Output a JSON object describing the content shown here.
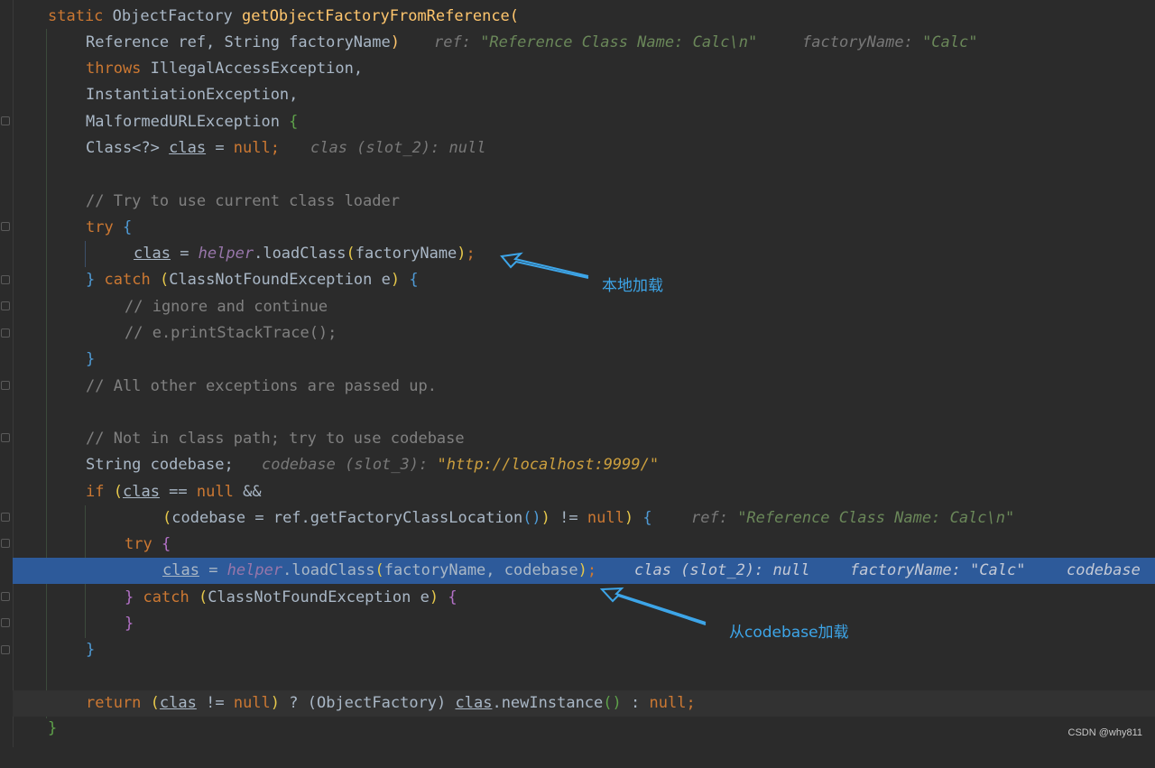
{
  "code": {
    "l1": {
      "kw": "static",
      "type": "ObjectFactory",
      "fn": "getObjectFactoryFromReference",
      "open": "("
    },
    "l2": {
      "text": "Reference ref, String factoryName",
      "close": ")",
      "hint1": "ref: ",
      "hint1v": "\"Reference Class Name: Calc\\n\"",
      "hint2": "factoryName: ",
      "hint2v": "\"Calc\""
    },
    "l3": {
      "kw": "throws",
      "text": " IllegalAccessException,"
    },
    "l4": {
      "text": "InstantiationException,"
    },
    "l5": {
      "text": "MalformedURLException ",
      "brace": "{"
    },
    "l6": {
      "pre": "Class<?> ",
      "var": "clas",
      "mid": " = ",
      "kw": "null",
      "end": ";",
      "hint": "clas (slot_2): null"
    },
    "l8": {
      "comment": "// Try to use current class loader"
    },
    "l9": {
      "kw": "try",
      "brace": "{"
    },
    "l10": {
      "var": "clas",
      "mid": " = ",
      "helper": "helper",
      "call": ".loadClass",
      "open": "(",
      "arg": "factoryName",
      "close": ")",
      "end": ";"
    },
    "l11": {
      "brace": "}",
      "kw": "catch",
      "open": "(",
      "text": "ClassNotFoundException e",
      "close": ")",
      "brace2": "{"
    },
    "l12": {
      "comment": "// ignore and continue"
    },
    "l13": {
      "comment": "// e.printStackTrace();"
    },
    "l14": {
      "brace": "}"
    },
    "l15": {
      "comment": "// All other exceptions are passed up."
    },
    "l17": {
      "comment": "// Not in class path; try to use codebase"
    },
    "l18": {
      "text": "String codebase;",
      "hint": "codebase (slot_3): ",
      "hintv": "\"http://localhost:9999/\""
    },
    "l19": {
      "kw": "if",
      "open": "(",
      "var": "clas",
      "mid": " == ",
      "kw2": "null",
      "end": " &&"
    },
    "l20": {
      "open": "(",
      "text": "codebase = ref.getFactoryClassLocation",
      "parens": "()",
      "close": ")",
      "mid": " != ",
      "kw": "null",
      "close2": ")",
      "brace": "{",
      "hint": "ref: ",
      "hintv": "\"Reference Class Name: Calc\\n\""
    },
    "l21": {
      "kw": "try",
      "brace": "{"
    },
    "l22": {
      "var": "clas",
      "mid": " = ",
      "helper": "helper",
      "call": ".loadClass",
      "open": "(",
      "arg": "factoryName, codebase",
      "close": ")",
      "end": ";",
      "hint1": "clas (slot_2): null",
      "hint2": "factoryName: ",
      "hint2v": "\"Calc\"",
      "hint3": "codebase"
    },
    "l23": {
      "brace": "}",
      "kw": "catch",
      "open": "(",
      "text": "ClassNotFoundException e",
      "close": ")",
      "brace2": "{"
    },
    "l24": {
      "brace": "}"
    },
    "l25": {
      "brace": "}"
    },
    "l27": {
      "kw": "return",
      "open": "(",
      "var": "clas",
      "mid": " != ",
      "kw2": "null",
      "close": ")",
      "q": " ? (ObjectFactory) ",
      "var2": "clas",
      "call": ".newInstance",
      "parens": "()",
      "colon": " : ",
      "kw3": "null",
      "end": ";"
    },
    "l28": {
      "brace": "}"
    }
  },
  "annotations": {
    "local": "本地加载",
    "codebase": "从codebase加载"
  },
  "watermark": "CSDN @why811"
}
